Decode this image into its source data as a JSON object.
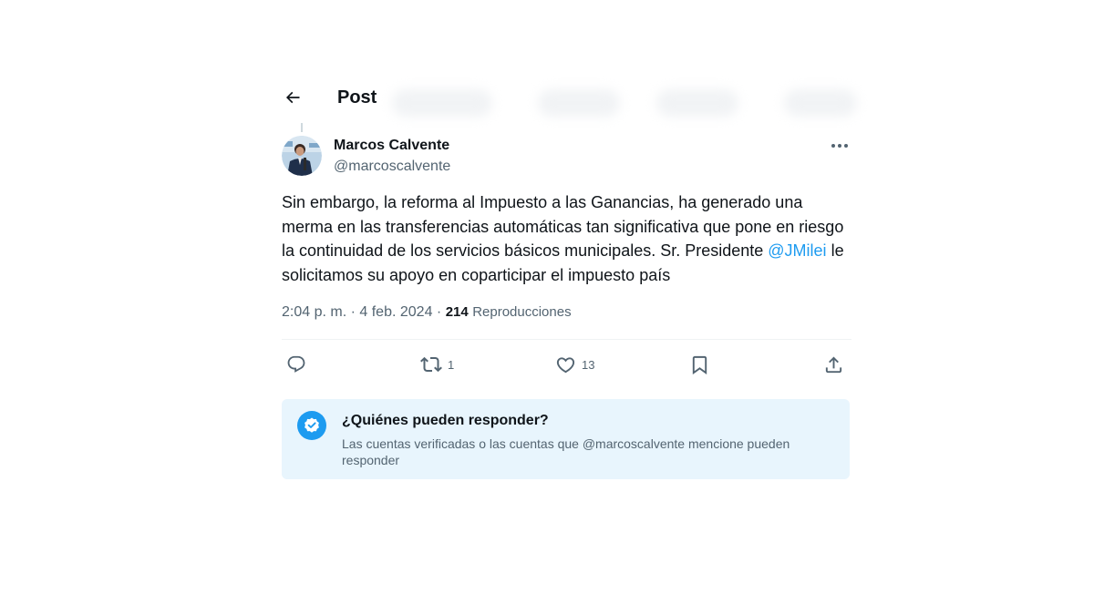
{
  "header": {
    "title": "Post"
  },
  "author": {
    "name": "Marcos Calvente",
    "handle": "@marcoscalvente"
  },
  "tweet": {
    "text_before": "Sin embargo, la reforma al Impuesto a las Ganancias, ha generado una merma en las transferencias automáticas tan significativa que pone en riesgo la continuidad de los servicios básicos municipales. Sr. Presidente ",
    "mention": "@JMilei",
    "text_after": " le solicitamos su apoyo en coparticipar el impuesto país"
  },
  "meta": {
    "time": "2:04 p. m.",
    "separator1": "·",
    "date": "4 feb. 2024",
    "separator2": "·",
    "views_count": "214",
    "views_label": "Reproducciones"
  },
  "actions": {
    "reply_icon": "reply-bubble-icon",
    "retweet_icon": "retweet-icon",
    "retweet_count": "1",
    "like_icon": "heart-icon",
    "like_count": "13",
    "bookmark_icon": "bookmark-icon",
    "share_icon": "share-upload-icon"
  },
  "who_can_reply": {
    "icon": "verified-check-icon",
    "title": "¿Quiénes pueden responder?",
    "description": "Las cuentas verificadas o las cuentas que @marcoscalvente mencione pueden responder"
  },
  "colors": {
    "accent": "#1d9bf0",
    "text_primary": "#0f1419",
    "text_secondary": "#536471",
    "reply_box_bg": "#e8f5fd"
  }
}
